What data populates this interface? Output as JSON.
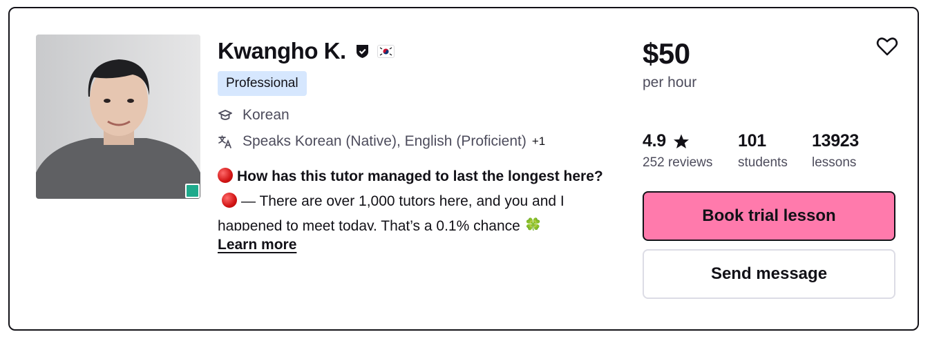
{
  "tutor": {
    "name": "Kwangho K.",
    "badge": "Professional",
    "subject": "Korean",
    "languages": "Speaks Korean (Native), English (Proficient)",
    "languages_more": "+1",
    "description": {
      "headline": "How has this tutor managed to last the longest here?",
      "body": "— There are over 1,000 tutors here, and you and I happened to meet today. That’s a 0.1% chance",
      "emoji_end": "🍀"
    },
    "learn_more": "Learn more",
    "online_status_color": "#1faa8c"
  },
  "pricing": {
    "price": "$50",
    "per": "per hour"
  },
  "stats": {
    "rating": "4.9",
    "reviews": "252 reviews",
    "students": "101",
    "students_label": "students",
    "lessons": "13923",
    "lessons_label": "lessons"
  },
  "actions": {
    "book": "Book trial lesson",
    "message": "Send message"
  },
  "icons": {
    "verified": "shield-check-icon",
    "flag": "south-korea-flag-icon",
    "subject": "graduation-cap-icon",
    "languages": "translate-icon",
    "favorite": "heart-outline-icon",
    "rating": "star-icon"
  },
  "colors": {
    "book_button": "#ff7aac",
    "badge_bg": "#d6e7fe",
    "text": "#121117",
    "muted": "#4d4c5c"
  }
}
